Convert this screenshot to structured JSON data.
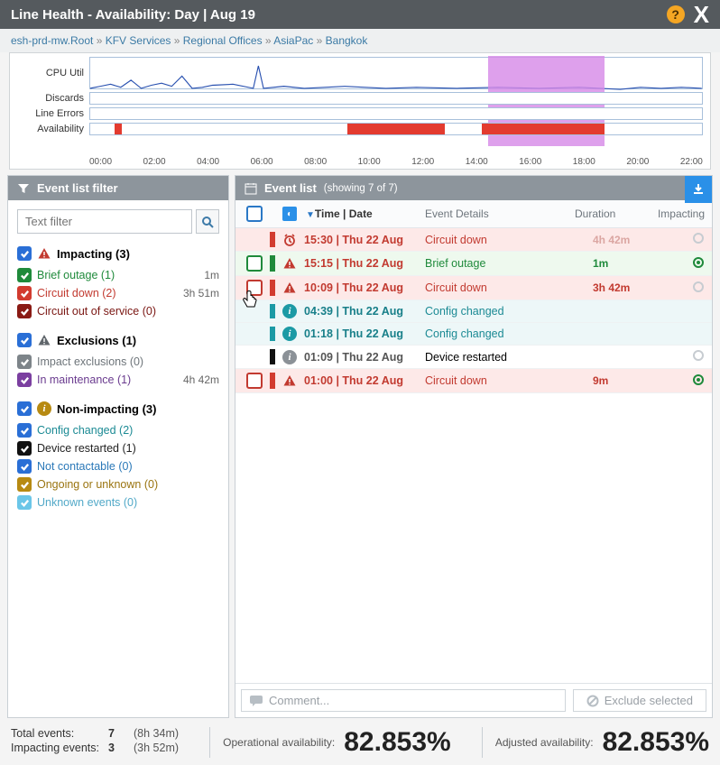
{
  "window": {
    "title": "Line Health - Availability: Day | Aug 19"
  },
  "breadcrumb": [
    "esh-prd-mw.Root",
    "KFV Services",
    "Regional Offices",
    "AsiaPac",
    "Bangkok"
  ],
  "chart": {
    "rows": [
      "CPU Util",
      "Discards",
      "Line Errors",
      "Availability"
    ],
    "axis": [
      "00:00",
      "02:00",
      "04:00",
      "06:00",
      "08:00",
      "10:00",
      "12:00",
      "14:00",
      "16:00",
      "18:00",
      "20:00",
      "22:00"
    ]
  },
  "filter": {
    "title": "Event list filter",
    "placeholder": "Text filter",
    "groups": [
      {
        "key": "impacting",
        "label": "Impacting (3)",
        "chk": "blue",
        "icon": "warn-red",
        "items": [
          {
            "chk": "green",
            "label": "Brief outage (1)",
            "cls": "txt-green",
            "dur": "1m"
          },
          {
            "chk": "red",
            "label": "Circuit down (2)",
            "cls": "txt-red",
            "dur": "3h 51m"
          },
          {
            "chk": "darkred",
            "label": "Circuit out of service (0)",
            "cls": "txt-darkred",
            "dur": ""
          }
        ]
      },
      {
        "key": "exclusions",
        "label": "Exclusions (1)",
        "chk": "blue",
        "icon": "warn-gray",
        "items": [
          {
            "chk": "gray",
            "label": "Impact exclusions (0)",
            "cls": "txt-gray",
            "dur": ""
          },
          {
            "chk": "purple",
            "label": "In maintenance (1)",
            "cls": "txt-purple",
            "dur": "4h 42m"
          }
        ]
      },
      {
        "key": "nonimpacting",
        "label": "Non-impacting (3)",
        "chk": "blue",
        "icon": "info-gold",
        "items": [
          {
            "chk": "blue",
            "label": "Config changed (2)",
            "cls": "txt-teal",
            "dur": ""
          },
          {
            "chk": "black",
            "label": "Device restarted (1)",
            "cls": "txt-black",
            "dur": ""
          },
          {
            "chk": "blue",
            "label": "Not contactable (0)",
            "cls": "txt-blue",
            "dur": ""
          },
          {
            "chk": "gold",
            "label": "Ongoing or unknown (0)",
            "cls": "txt-gold",
            "dur": ""
          },
          {
            "chk": "cyan",
            "label": "Unknown events (0)",
            "cls": "txt-cyan",
            "dur": ""
          }
        ]
      }
    ]
  },
  "events": {
    "title": "Event list",
    "showing": "(showing 7 of 7)",
    "cols": {
      "time": "Time | Date",
      "details": "Event Details",
      "duration": "Duration",
      "impacting": "Impacting"
    },
    "rows": [
      {
        "chk": "hidden",
        "marker": "red",
        "icon": "alarm",
        "rowcls": "red",
        "time": "15:30 | Thu 22 Aug",
        "timecls": "",
        "det": "Circuit down",
        "detcls": "txt-red",
        "dur": "4h 42m",
        "durcls": "fade",
        "imp": "ring"
      },
      {
        "chk": "green",
        "marker": "green",
        "icon": "warn-red",
        "rowcls": "green",
        "time": "15:15 | Thu 22 Aug",
        "timecls": "",
        "det": "Brief outage",
        "detcls": "txt-green",
        "dur": "1m",
        "durcls": "green",
        "imp": "target-green"
      },
      {
        "chk": "red",
        "marker": "red",
        "icon": "warn-red",
        "rowcls": "red",
        "time": "10:09 | Thu 22 Aug",
        "timecls": "",
        "det": "Circuit down",
        "detcls": "txt-red",
        "dur": "3h 42m",
        "durcls": "",
        "imp": "ring"
      },
      {
        "chk": "hidden",
        "marker": "teal",
        "icon": "info-teal",
        "rowcls": "teal",
        "time": "04:39 | Thu 22 Aug",
        "timecls": "teal",
        "det": "Config changed",
        "detcls": "txt-teal",
        "dur": "",
        "durcls": "",
        "imp": ""
      },
      {
        "chk": "hidden",
        "marker": "teal",
        "icon": "info-teal",
        "rowcls": "teal",
        "time": "01:18 | Thu 22 Aug",
        "timecls": "teal",
        "det": "Config changed",
        "detcls": "txt-teal",
        "dur": "",
        "durcls": "",
        "imp": ""
      },
      {
        "chk": "hidden",
        "marker": "black",
        "icon": "info-gray",
        "rowcls": "",
        "time": "01:09 | Thu 22 Aug",
        "timecls": "gray",
        "det": "Device restarted",
        "detcls": "",
        "dur": "",
        "durcls": "",
        "imp": "ring"
      },
      {
        "chk": "red",
        "marker": "red",
        "icon": "warn-red",
        "rowcls": "red",
        "time": "01:00 | Thu 22 Aug",
        "timecls": "",
        "det": "Circuit down",
        "detcls": "txt-red",
        "dur": "9m",
        "durcls": "",
        "imp": "target-green"
      }
    ],
    "comment_placeholder": "Comment...",
    "exclude_label": "Exclude selected"
  },
  "stats": {
    "total_label": "Total events:",
    "total_n": "7",
    "total_d": "(8h 34m)",
    "imp_label": "Impacting events:",
    "imp_n": "3",
    "imp_d": "(3h 52m)",
    "op_label": "Operational availability:",
    "op_val": "82.853%",
    "adj_label": "Adjusted availability:",
    "adj_val": "82.853%"
  }
}
